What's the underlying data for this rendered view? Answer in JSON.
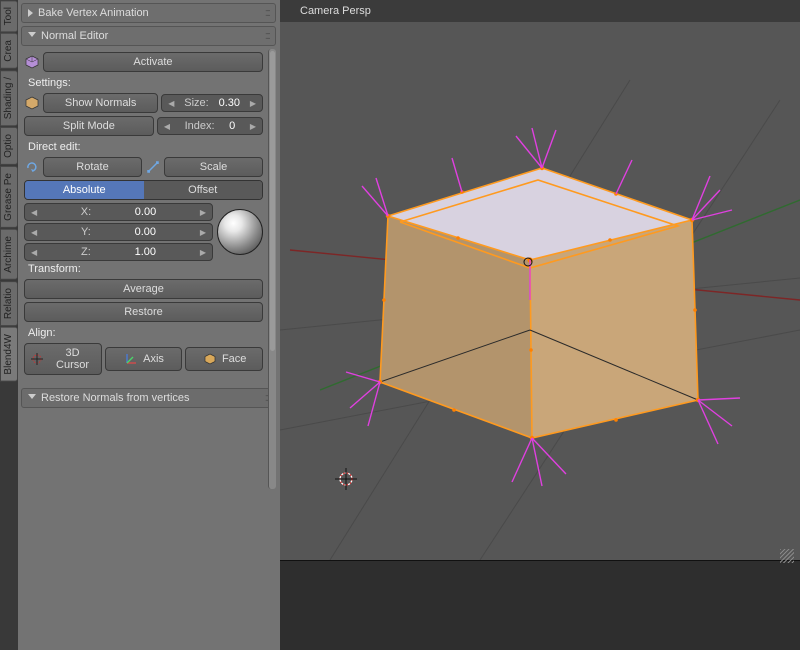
{
  "vtabs": [
    "Tool",
    "Crea",
    "Shading /",
    "Optio",
    "Grease Pe",
    "Archime",
    "Relatio",
    "Blend4W"
  ],
  "panels": {
    "bake": "Bake Vertex Animation",
    "normal": "Normal Editor",
    "restore_normals": "Restore Normals from vertices"
  },
  "normal_editor": {
    "activate": "Activate",
    "settings_label": "Settings:",
    "show_normals": "Show Normals",
    "size_label": "Size:",
    "size_value": "0.30",
    "split_mode": "Split Mode",
    "index_label": "Index:",
    "index_value": "0",
    "direct_edit": "Direct edit:",
    "rotate": "Rotate",
    "scale": "Scale",
    "absolute": "Absolute",
    "offset": "Offset",
    "x_label": "X:",
    "x_value": "0.00",
    "y_label": "Y:",
    "y_value": "0.00",
    "z_label": "Z:",
    "z_value": "1.00",
    "transform_label": "Transform:",
    "average": "Average",
    "restore": "Restore",
    "align_label": "Align:",
    "cursor3d": "3D Cursor",
    "axis": "Axis",
    "face": "Face"
  },
  "viewport": {
    "label": "Camera Persp"
  },
  "colors": {
    "accent": "#5577b8",
    "normal_lines": "#e040e0",
    "edge_select": "#ff9a1f",
    "vertex": "#ff8000"
  }
}
